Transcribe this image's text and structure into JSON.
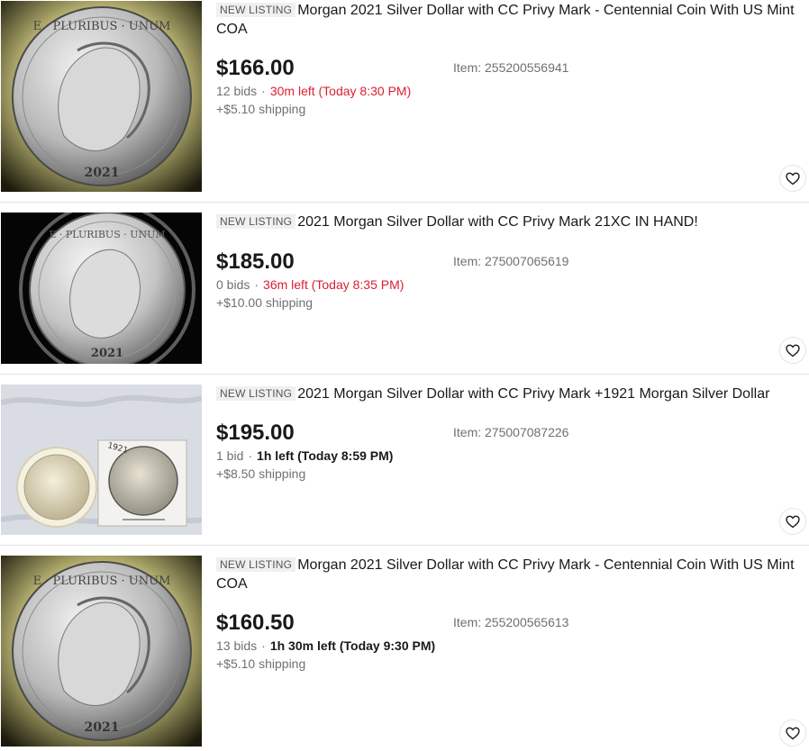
{
  "listings": [
    {
      "badge": "NEW LISTING",
      "title": "Morgan 2021 Silver Dollar with CC Privy Mark - Centennial Coin With US Mint COA",
      "price": "$166.00",
      "item_id": "Item: 255200556941",
      "bids": "12 bids",
      "sep": "·",
      "time_left": "30m left (Today 8:30 PM)",
      "shipping": "+$5.10 shipping",
      "coin_year": "2021",
      "coin_legend": "E · PLURIBUS · UNUM"
    },
    {
      "badge": "NEW LISTING",
      "title": "2021 Morgan Silver Dollar with CC Privy Mark 21XC IN HAND!",
      "price": "$185.00",
      "item_id": "Item: 275007065619",
      "bids": "0 bids",
      "sep": "·",
      "time_left": "36m left (Today 8:35 PM)",
      "shipping": "+$10.00 shipping",
      "coin_year": "2021",
      "coin_legend": "E · PLURIBUS · UNUM"
    },
    {
      "badge": "NEW LISTING",
      "title": "2021 Morgan Silver Dollar with CC Privy Mark +1921 Morgan Silver Dollar",
      "price": "$195.00",
      "item_id": "Item: 275007087226",
      "bids": "1 bid",
      "sep": "·",
      "time_left": "1h left (Today 8:59 PM)",
      "shipping": "+$8.50 shipping",
      "coin_year": "1921"
    },
    {
      "badge": "NEW LISTING",
      "title": "Morgan 2021 Silver Dollar with CC Privy Mark - Centennial Coin With US Mint COA",
      "price": "$160.50",
      "item_id": "Item: 255200565613",
      "bids": "13 bids",
      "sep": "·",
      "time_left": "1h 30m left (Today 9:30 PM)",
      "shipping": "+$5.10 shipping",
      "coin_year": "2021",
      "coin_legend": "E · PLURIBUS · UNUM"
    }
  ],
  "icons": {
    "watch": "heart-icon"
  },
  "colors": {
    "urgent": "#dd1e31",
    "muted": "#707070",
    "text": "#191919",
    "badge_bg": "#f0f0f0"
  }
}
